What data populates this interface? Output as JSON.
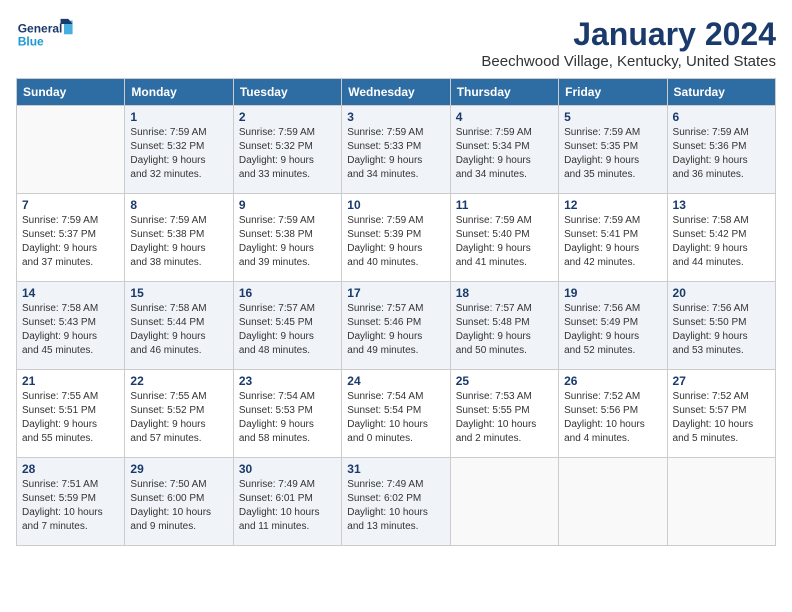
{
  "header": {
    "logo_line1": "General",
    "logo_line2": "Blue",
    "month_title": "January 2024",
    "location": "Beechwood Village, Kentucky, United States"
  },
  "days_of_week": [
    "Sunday",
    "Monday",
    "Tuesday",
    "Wednesday",
    "Thursday",
    "Friday",
    "Saturday"
  ],
  "weeks": [
    [
      {
        "day": "",
        "info": ""
      },
      {
        "day": "1",
        "info": "Sunrise: 7:59 AM\nSunset: 5:32 PM\nDaylight: 9 hours\nand 32 minutes."
      },
      {
        "day": "2",
        "info": "Sunrise: 7:59 AM\nSunset: 5:32 PM\nDaylight: 9 hours\nand 33 minutes."
      },
      {
        "day": "3",
        "info": "Sunrise: 7:59 AM\nSunset: 5:33 PM\nDaylight: 9 hours\nand 34 minutes."
      },
      {
        "day": "4",
        "info": "Sunrise: 7:59 AM\nSunset: 5:34 PM\nDaylight: 9 hours\nand 34 minutes."
      },
      {
        "day": "5",
        "info": "Sunrise: 7:59 AM\nSunset: 5:35 PM\nDaylight: 9 hours\nand 35 minutes."
      },
      {
        "day": "6",
        "info": "Sunrise: 7:59 AM\nSunset: 5:36 PM\nDaylight: 9 hours\nand 36 minutes."
      }
    ],
    [
      {
        "day": "7",
        "info": "Sunrise: 7:59 AM\nSunset: 5:37 PM\nDaylight: 9 hours\nand 37 minutes."
      },
      {
        "day": "8",
        "info": "Sunrise: 7:59 AM\nSunset: 5:38 PM\nDaylight: 9 hours\nand 38 minutes."
      },
      {
        "day": "9",
        "info": "Sunrise: 7:59 AM\nSunset: 5:38 PM\nDaylight: 9 hours\nand 39 minutes."
      },
      {
        "day": "10",
        "info": "Sunrise: 7:59 AM\nSunset: 5:39 PM\nDaylight: 9 hours\nand 40 minutes."
      },
      {
        "day": "11",
        "info": "Sunrise: 7:59 AM\nSunset: 5:40 PM\nDaylight: 9 hours\nand 41 minutes."
      },
      {
        "day": "12",
        "info": "Sunrise: 7:59 AM\nSunset: 5:41 PM\nDaylight: 9 hours\nand 42 minutes."
      },
      {
        "day": "13",
        "info": "Sunrise: 7:58 AM\nSunset: 5:42 PM\nDaylight: 9 hours\nand 44 minutes."
      }
    ],
    [
      {
        "day": "14",
        "info": "Sunrise: 7:58 AM\nSunset: 5:43 PM\nDaylight: 9 hours\nand 45 minutes."
      },
      {
        "day": "15",
        "info": "Sunrise: 7:58 AM\nSunset: 5:44 PM\nDaylight: 9 hours\nand 46 minutes."
      },
      {
        "day": "16",
        "info": "Sunrise: 7:57 AM\nSunset: 5:45 PM\nDaylight: 9 hours\nand 48 minutes."
      },
      {
        "day": "17",
        "info": "Sunrise: 7:57 AM\nSunset: 5:46 PM\nDaylight: 9 hours\nand 49 minutes."
      },
      {
        "day": "18",
        "info": "Sunrise: 7:57 AM\nSunset: 5:48 PM\nDaylight: 9 hours\nand 50 minutes."
      },
      {
        "day": "19",
        "info": "Sunrise: 7:56 AM\nSunset: 5:49 PM\nDaylight: 9 hours\nand 52 minutes."
      },
      {
        "day": "20",
        "info": "Sunrise: 7:56 AM\nSunset: 5:50 PM\nDaylight: 9 hours\nand 53 minutes."
      }
    ],
    [
      {
        "day": "21",
        "info": "Sunrise: 7:55 AM\nSunset: 5:51 PM\nDaylight: 9 hours\nand 55 minutes."
      },
      {
        "day": "22",
        "info": "Sunrise: 7:55 AM\nSunset: 5:52 PM\nDaylight: 9 hours\nand 57 minutes."
      },
      {
        "day": "23",
        "info": "Sunrise: 7:54 AM\nSunset: 5:53 PM\nDaylight: 9 hours\nand 58 minutes."
      },
      {
        "day": "24",
        "info": "Sunrise: 7:54 AM\nSunset: 5:54 PM\nDaylight: 10 hours\nand 0 minutes."
      },
      {
        "day": "25",
        "info": "Sunrise: 7:53 AM\nSunset: 5:55 PM\nDaylight: 10 hours\nand 2 minutes."
      },
      {
        "day": "26",
        "info": "Sunrise: 7:52 AM\nSunset: 5:56 PM\nDaylight: 10 hours\nand 4 minutes."
      },
      {
        "day": "27",
        "info": "Sunrise: 7:52 AM\nSunset: 5:57 PM\nDaylight: 10 hours\nand 5 minutes."
      }
    ],
    [
      {
        "day": "28",
        "info": "Sunrise: 7:51 AM\nSunset: 5:59 PM\nDaylight: 10 hours\nand 7 minutes."
      },
      {
        "day": "29",
        "info": "Sunrise: 7:50 AM\nSunset: 6:00 PM\nDaylight: 10 hours\nand 9 minutes."
      },
      {
        "day": "30",
        "info": "Sunrise: 7:49 AM\nSunset: 6:01 PM\nDaylight: 10 hours\nand 11 minutes."
      },
      {
        "day": "31",
        "info": "Sunrise: 7:49 AM\nSunset: 6:02 PM\nDaylight: 10 hours\nand 13 minutes."
      },
      {
        "day": "",
        "info": ""
      },
      {
        "day": "",
        "info": ""
      },
      {
        "day": "",
        "info": ""
      }
    ]
  ]
}
